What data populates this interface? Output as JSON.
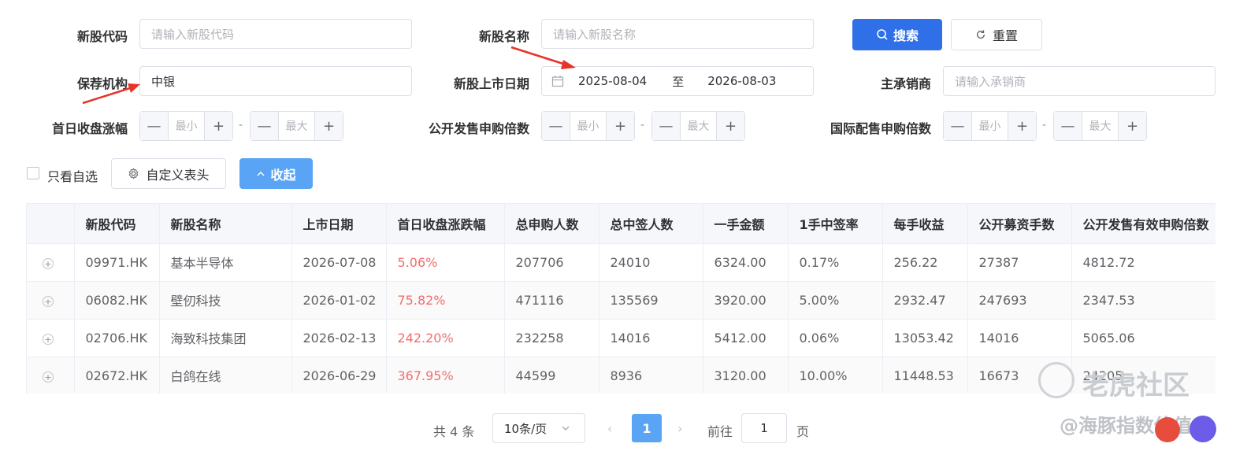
{
  "filters": {
    "code": {
      "label": "新股代码",
      "placeholder": "请输入新股代码"
    },
    "name": {
      "label": "新股名称",
      "placeholder": "请输入新股名称"
    },
    "sponsor": {
      "label": "保荐机构",
      "value": "中银"
    },
    "listing_date": {
      "label": "新股上市日期",
      "start": "2025-08-04",
      "sep": "至",
      "end": "2026-08-03"
    },
    "underwriter": {
      "label": "主承销商",
      "placeholder": "请输入承销商"
    },
    "first_day_change": {
      "label": "首日收盘涨幅",
      "min": "最小",
      "max": "最大"
    },
    "public_multiple": {
      "label": "公开发售申购倍数",
      "min": "最小",
      "max": "最大"
    },
    "intl_multiple": {
      "label": "国际配售申购倍数",
      "min": "最小",
      "max": "最大"
    },
    "minus": "—",
    "plus": "+",
    "range_dash": "-"
  },
  "actions": {
    "search": "搜索",
    "reset": "重置",
    "watchlist_only": "只看自选",
    "custom_header": "自定义表头",
    "collapse": "收起"
  },
  "table": {
    "columns": [
      "新股代码",
      "新股名称",
      "上市日期",
      "首日收盘涨跌幅",
      "总申购人数",
      "总中签人数",
      "一手金额",
      "1手中签率",
      "每手收益",
      "公开募资手数",
      "公开发售有效申购倍数"
    ],
    "rows": [
      [
        "09971.HK",
        "基本半导体",
        "2026-07-08",
        "5.06%",
        "207706",
        "24010",
        "6324.00",
        "0.17%",
        "256.22",
        "27387",
        "4812.72"
      ],
      [
        "06082.HK",
        "壁仞科技",
        "2026-01-02",
        "75.82%",
        "471116",
        "135569",
        "3920.00",
        "5.00%",
        "2932.47",
        "247693",
        "2347.53"
      ],
      [
        "02706.HK",
        "海致科技集团",
        "2026-02-13",
        "242.20%",
        "232258",
        "14016",
        "5412.00",
        "0.06%",
        "13053.42",
        "14016",
        "5065.06"
      ],
      [
        "02672.HK",
        "白鸽在线",
        "2026-06-29",
        "367.95%",
        "44599",
        "8936",
        "3120.00",
        "10.00%",
        "11448.53",
        "16673",
        "24205"
      ]
    ]
  },
  "pagination": {
    "total": "共 4 条",
    "page_size": "10条/页",
    "current": "1",
    "goto_prefix": "前往",
    "goto_value": "1",
    "goto_suffix": "页"
  },
  "watermark": {
    "brand": "老虎社区",
    "author": "@海豚指数估值"
  },
  "colors": {
    "primary": "#2f6fe8",
    "collapse": "#5aa4f5",
    "up": "#f56c6c",
    "arrow": "#e8332a"
  }
}
